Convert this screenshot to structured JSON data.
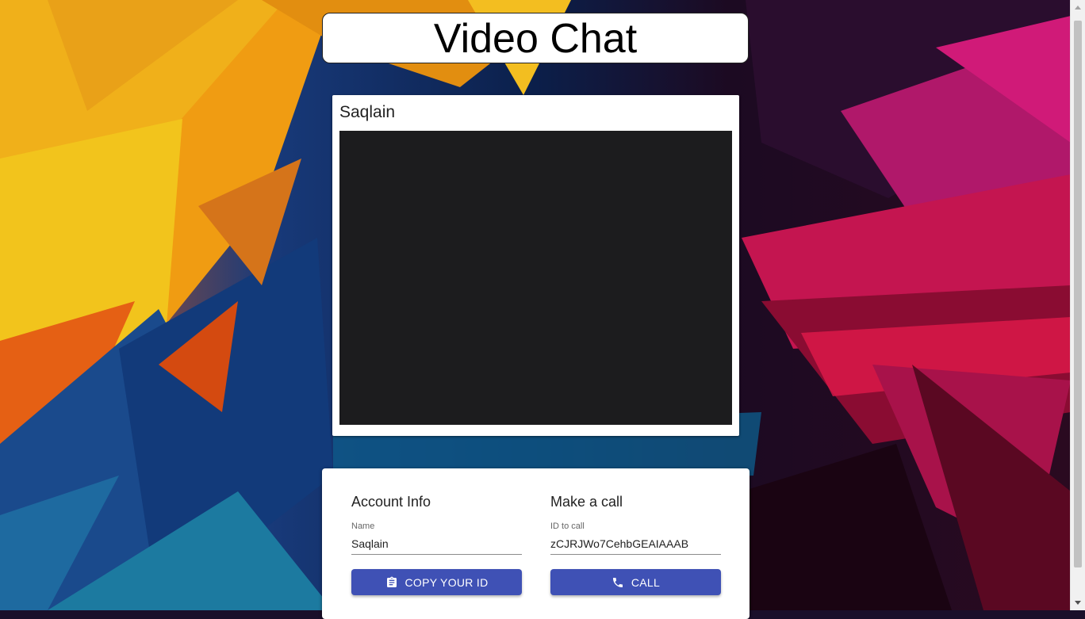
{
  "header": {
    "title": "Video Chat"
  },
  "video": {
    "caller_name": "Saqlain"
  },
  "account": {
    "heading": "Account Info",
    "name_label": "Name",
    "name_value": "Saqlain",
    "copy_button_label": "COPY YOUR ID",
    "copy_icon": "clipboard-icon"
  },
  "call": {
    "heading": "Make a call",
    "id_label": "ID to call",
    "id_value": "zCJRJWo7CehbGEAIAAAB",
    "call_button_label": "CALL",
    "call_icon": "phone-icon"
  },
  "colors": {
    "button": "#3f51b5",
    "video_background": "#1c1c1e"
  }
}
